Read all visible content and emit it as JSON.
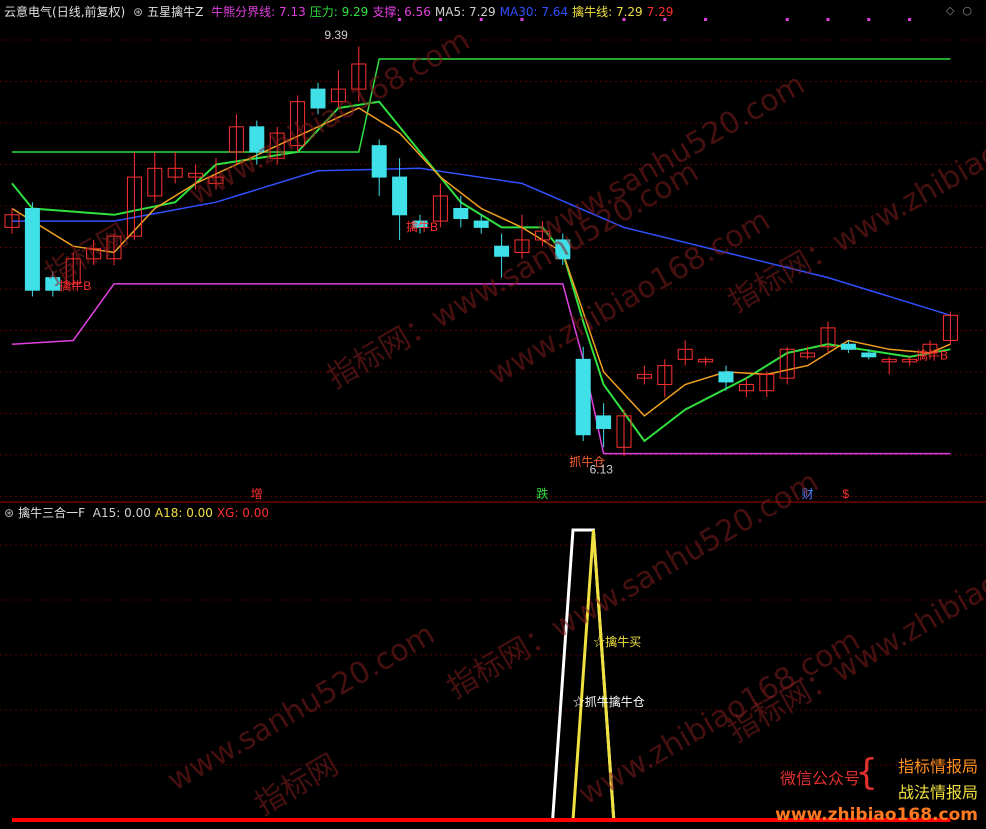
{
  "main_header": {
    "stock": "云意电气",
    "period": "(日线,前复权)",
    "indicator": "五星擒牛Z",
    "fields": [
      {
        "label": "牛熊分界线:",
        "value": "7.13",
        "color": "#e040e0"
      },
      {
        "label": "压力:",
        "value": "9.29",
        "color": "#30e040"
      },
      {
        "label": "支撑:",
        "value": "6.56",
        "color": "#e040e0"
      },
      {
        "label": "MA5:",
        "value": "7.29",
        "color": "#d0d0d0"
      },
      {
        "label": "MA30:",
        "value": "7.64",
        "color": "#3050ff"
      },
      {
        "label": "擒牛线:",
        "value": "7.29",
        "color": "#f0e040"
      },
      {
        "label": "",
        "value": "7.29",
        "color": "#ff3030"
      }
    ]
  },
  "sub_header": {
    "indicator": "擒牛三合一F",
    "fields": [
      {
        "label": "A15:",
        "value": "0.00",
        "color": "#d0d0d0"
      },
      {
        "label": "A18:",
        "value": "0.00",
        "color": "#f0e040"
      },
      {
        "label": "XG:",
        "value": "0.00",
        "color": "#ff3030"
      }
    ]
  },
  "chart_data": [
    {
      "type": "candlestick",
      "ylim": [
        5.9,
        9.6
      ],
      "candles": [
        {
          "o": 7.95,
          "c": 8.05,
          "h": 8.1,
          "l": 7.9
        },
        {
          "o": 8.1,
          "c": 7.45,
          "h": 8.15,
          "l": 7.4
        },
        {
          "o": 7.55,
          "c": 7.45,
          "h": 7.6,
          "l": 7.4
        },
        {
          "o": 7.5,
          "c": 7.7,
          "h": 7.75,
          "l": 7.45
        },
        {
          "o": 7.7,
          "c": 7.78,
          "h": 7.85,
          "l": 7.65
        },
        {
          "o": 7.7,
          "c": 7.88,
          "h": 7.9,
          "l": 7.65
        },
        {
          "o": 7.88,
          "c": 8.35,
          "h": 8.55,
          "l": 7.85
        },
        {
          "o": 8.2,
          "c": 8.42,
          "h": 8.55,
          "l": 8.15
        },
        {
          "o": 8.35,
          "c": 8.42,
          "h": 8.55,
          "l": 8.3
        },
        {
          "o": 8.35,
          "c": 8.38,
          "h": 8.45,
          "l": 8.25
        },
        {
          "o": 8.3,
          "c": 8.35,
          "h": 8.5,
          "l": 8.25
        },
        {
          "o": 8.55,
          "c": 8.75,
          "h": 8.85,
          "l": 8.45
        },
        {
          "o": 8.75,
          "c": 8.55,
          "h": 8.8,
          "l": 8.45
        },
        {
          "o": 8.5,
          "c": 8.7,
          "h": 8.75,
          "l": 8.45
        },
        {
          "o": 8.6,
          "c": 8.95,
          "h": 9.0,
          "l": 8.55
        },
        {
          "o": 9.05,
          "c": 8.9,
          "h": 9.1,
          "l": 8.85
        },
        {
          "o": 8.95,
          "c": 9.05,
          "h": 9.2,
          "l": 8.9
        },
        {
          "o": 9.05,
          "c": 9.25,
          "h": 9.39,
          "l": 8.95
        },
        {
          "o": 8.6,
          "c": 8.35,
          "h": 8.65,
          "l": 8.2
        },
        {
          "o": 8.35,
          "c": 8.05,
          "h": 8.5,
          "l": 7.85
        },
        {
          "o": 8.0,
          "c": 7.95,
          "h": 8.05,
          "l": 7.9
        },
        {
          "o": 8.0,
          "c": 8.2,
          "h": 8.3,
          "l": 7.95
        },
        {
          "o": 8.1,
          "c": 8.02,
          "h": 8.2,
          "l": 7.95
        },
        {
          "o": 8.0,
          "c": 7.95,
          "h": 8.05,
          "l": 7.9
        },
        {
          "o": 7.8,
          "c": 7.72,
          "h": 7.9,
          "l": 7.55
        },
        {
          "o": 7.75,
          "c": 7.85,
          "h": 8.05,
          "l": 7.7
        },
        {
          "o": 7.85,
          "c": 7.92,
          "h": 8.0,
          "l": 7.8
        },
        {
          "o": 7.85,
          "c": 7.7,
          "h": 7.9,
          "l": 7.65
        },
        {
          "o": 6.9,
          "c": 6.3,
          "h": 7.0,
          "l": 6.25
        },
        {
          "o": 6.45,
          "c": 6.35,
          "h": 6.55,
          "l": 6.2
        },
        {
          "o": 6.2,
          "c": 6.45,
          "h": 6.5,
          "l": 6.13
        },
        {
          "o": 6.75,
          "c": 6.78,
          "h": 6.85,
          "l": 6.7
        },
        {
          "o": 6.7,
          "c": 6.85,
          "h": 6.9,
          "l": 6.6
        },
        {
          "o": 6.9,
          "c": 6.98,
          "h": 7.05,
          "l": 6.85
        },
        {
          "o": 6.88,
          "c": 6.9,
          "h": 6.92,
          "l": 6.85
        },
        {
          "o": 6.8,
          "c": 6.72,
          "h": 6.85,
          "l": 6.65
        },
        {
          "o": 6.65,
          "c": 6.7,
          "h": 6.75,
          "l": 6.6
        },
        {
          "o": 6.65,
          "c": 6.78,
          "h": 6.8,
          "l": 6.6
        },
        {
          "o": 6.75,
          "c": 6.98,
          "h": 7.0,
          "l": 6.7
        },
        {
          "o": 6.92,
          "c": 6.95,
          "h": 7.0,
          "l": 6.9
        },
        {
          "o": 7.0,
          "c": 7.15,
          "h": 7.2,
          "l": 6.95
        },
        {
          "o": 7.02,
          "c": 6.98,
          "h": 7.05,
          "l": 6.95
        },
        {
          "o": 6.95,
          "c": 6.92,
          "h": 6.98,
          "l": 6.9
        },
        {
          "o": 6.88,
          "c": 6.9,
          "h": 6.92,
          "l": 6.78
        },
        {
          "o": 6.88,
          "c": 6.9,
          "h": 6.92,
          "l": 6.85
        },
        {
          "o": 6.95,
          "c": 7.02,
          "h": 7.05,
          "l": 6.9
        },
        {
          "o": 7.05,
          "c": 7.25,
          "h": 7.28,
          "l": 7.02
        }
      ],
      "lines": [
        {
          "name": "压力",
          "color": "#30e040",
          "values": [
            {
              "x": 0,
              "y": 8.55
            },
            {
              "x": 17,
              "y": 8.55
            },
            {
              "x": 18,
              "y": 9.29
            },
            {
              "x": 46,
              "y": 9.29
            }
          ]
        },
        {
          "name": "支撑",
          "color": "#e040e0",
          "values": [
            {
              "x": 0,
              "y": 7.02
            },
            {
              "x": 3,
              "y": 7.05
            },
            {
              "x": 5,
              "y": 7.5
            },
            {
              "x": 27,
              "y": 7.5
            },
            {
              "x": 28,
              "y": 6.9
            },
            {
              "x": 29,
              "y": 6.15
            },
            {
              "x": 46,
              "y": 6.15
            }
          ]
        },
        {
          "name": "MA30",
          "color": "#3050ff",
          "values": [
            {
              "x": 0,
              "y": 8.0
            },
            {
              "x": 5,
              "y": 8.0
            },
            {
              "x": 10,
              "y": 8.15
            },
            {
              "x": 15,
              "y": 8.4
            },
            {
              "x": 20,
              "y": 8.42
            },
            {
              "x": 25,
              "y": 8.3
            },
            {
              "x": 30,
              "y": 7.95
            },
            {
              "x": 35,
              "y": 7.75
            },
            {
              "x": 40,
              "y": 7.55
            },
            {
              "x": 46,
              "y": 7.25
            }
          ]
        },
        {
          "name": "擒牛线",
          "color": "#30e040",
          "values": [
            {
              "x": 0,
              "y": 8.3
            },
            {
              "x": 1,
              "y": 8.1
            },
            {
              "x": 5,
              "y": 8.05
            },
            {
              "x": 8,
              "y": 8.15
            },
            {
              "x": 10,
              "y": 8.45
            },
            {
              "x": 14,
              "y": 8.55
            },
            {
              "x": 16,
              "y": 8.9
            },
            {
              "x": 18,
              "y": 8.95
            },
            {
              "x": 20,
              "y": 8.55
            },
            {
              "x": 22,
              "y": 8.15
            },
            {
              "x": 24,
              "y": 7.95
            },
            {
              "x": 26,
              "y": 7.95
            },
            {
              "x": 27,
              "y": 7.75
            },
            {
              "x": 28,
              "y": 7.2
            },
            {
              "x": 29,
              "y": 6.7
            },
            {
              "x": 31,
              "y": 6.25
            },
            {
              "x": 33,
              "y": 6.5
            },
            {
              "x": 36,
              "y": 6.75
            },
            {
              "x": 38,
              "y": 6.95
            },
            {
              "x": 40,
              "y": 7.02
            },
            {
              "x": 42,
              "y": 6.97
            },
            {
              "x": 44,
              "y": 6.92
            },
            {
              "x": 46,
              "y": 6.98
            }
          ]
        },
        {
          "name": "MA5",
          "color": "#f0a020",
          "values": [
            {
              "x": 0,
              "y": 8.1
            },
            {
              "x": 3,
              "y": 7.8
            },
            {
              "x": 5,
              "y": 7.75
            },
            {
              "x": 7,
              "y": 8.1
            },
            {
              "x": 9,
              "y": 8.3
            },
            {
              "x": 11,
              "y": 8.45
            },
            {
              "x": 13,
              "y": 8.6
            },
            {
              "x": 15,
              "y": 8.75
            },
            {
              "x": 17,
              "y": 8.9
            },
            {
              "x": 19,
              "y": 8.7
            },
            {
              "x": 21,
              "y": 8.35
            },
            {
              "x": 23,
              "y": 8.1
            },
            {
              "x": 25,
              "y": 7.95
            },
            {
              "x": 27,
              "y": 7.75
            },
            {
              "x": 29,
              "y": 6.8
            },
            {
              "x": 31,
              "y": 6.45
            },
            {
              "x": 33,
              "y": 6.7
            },
            {
              "x": 35,
              "y": 6.8
            },
            {
              "x": 37,
              "y": 6.78
            },
            {
              "x": 39,
              "y": 6.85
            },
            {
              "x": 41,
              "y": 7.05
            },
            {
              "x": 43,
              "y": 6.98
            },
            {
              "x": 45,
              "y": 6.95
            },
            {
              "x": 46,
              "y": 7.02
            }
          ]
        }
      ],
      "annotations": [
        {
          "text": "擒牛B",
          "x": 3,
          "y": 7.45,
          "color": "#ff3030"
        },
        {
          "text": "擒牛B",
          "x": 20,
          "y": 7.92,
          "color": "#ff3030"
        },
        {
          "text": "擒牛B",
          "x": 45,
          "y": 6.9,
          "color": "#ff3030"
        },
        {
          "text": "抓牛仓",
          "x": 28,
          "y": 6.05,
          "color": "#ff6030"
        },
        {
          "text": "6.13",
          "x": 29,
          "y": 5.99,
          "color": "#d0d0d0"
        },
        {
          "text": "9.39",
          "x": 16,
          "y": 9.45,
          "color": "#d0d0d0"
        }
      ],
      "events": [
        {
          "text": "增",
          "x": 12,
          "color": "#ff3030"
        },
        {
          "text": "跌",
          "x": 26,
          "color": "#30e040"
        },
        {
          "text": "财",
          "x": 39,
          "color": "#5080ff"
        },
        {
          "text": "$",
          "x": 41,
          "color": "#ff3030"
        }
      ]
    },
    {
      "type": "line",
      "ylim": [
        0,
        1
      ],
      "series": [
        {
          "name": "A15",
          "color": "#ffffff",
          "values": [
            {
              "x": 26.5,
              "y": 0
            },
            {
              "x": 27.5,
              "y": 1
            },
            {
              "x": 28.5,
              "y": 1
            },
            {
              "x": 29.5,
              "y": 0
            }
          ]
        },
        {
          "name": "A18",
          "color": "#f0e040",
          "values": [
            {
              "x": 27.5,
              "y": 0
            },
            {
              "x": 28.5,
              "y": 1
            },
            {
              "x": 29.5,
              "y": 0
            }
          ]
        },
        {
          "name": "XG",
          "color": "#ff0000",
          "values": [
            {
              "x": 0,
              "y": 0
            },
            {
              "x": 46,
              "y": 0
            }
          ]
        }
      ],
      "annotations": [
        {
          "text": "☆擒牛买",
          "color": "#f0e040"
        },
        {
          "text": "☆抓牛擒牛仓",
          "color": "#ffffff"
        }
      ]
    }
  ],
  "watermarks": [
    "www.zhibiao168.com",
    "www.sanhu520.com",
    "指标网：www.sanhu520.com",
    "指标网：www.zhibiao168.com",
    "指标网"
  ],
  "branding": {
    "left": "微信公众号",
    "right1": "指标情报局",
    "right2": "战法情报局",
    "site": "www.zhibiao168.com"
  }
}
